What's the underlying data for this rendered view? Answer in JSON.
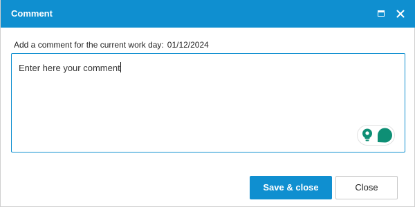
{
  "dialog": {
    "title": "Comment",
    "maximize_icon": "maximize-icon",
    "close_icon": "close-icon"
  },
  "prompt": {
    "label": "Add a comment for the current work day:",
    "date": "01/12/2024"
  },
  "comment": {
    "value": "Enter here your comment"
  },
  "widget": {
    "icons": [
      "lightbulb-icon",
      "speech-bubble-icon"
    ]
  },
  "buttons": {
    "save_label": "Save & close",
    "close_label": "Close"
  },
  "colors": {
    "accent": "#0f8fd0",
    "widget_green": "#0e8f75"
  }
}
